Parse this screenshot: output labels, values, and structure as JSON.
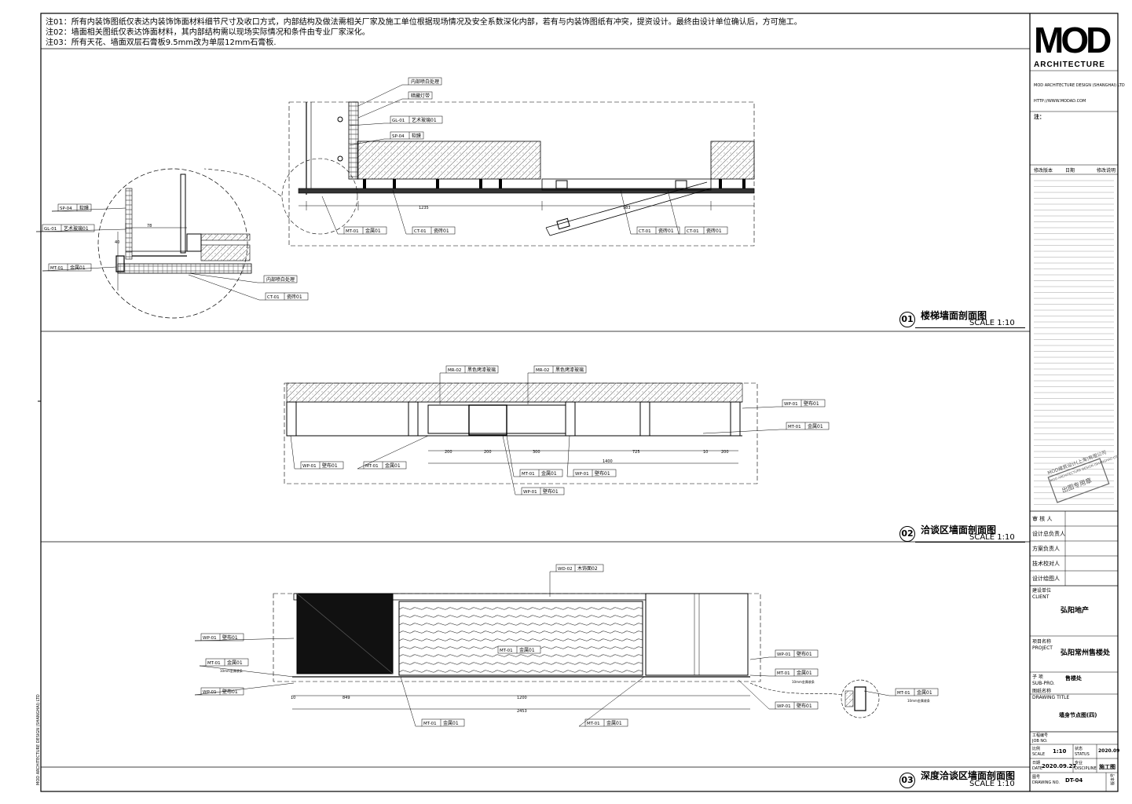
{
  "notes": [
    "注01：所有内装饰图纸仅表达内装饰饰面材料细节尺寸及收口方式，内部结构及做法需相关厂家及施工单位根据现场情况及安全系数深化内部，若有与内装饰图纸有冲突，提资设计。最终由设计单位确认后，方可施工。",
    "注02：墙面相关图纸仅表达饰面材料，其内部结构需以现场实际情况和条件由专业厂家深化。",
    "注03：所有天花、墙面双层石膏板9.5mm改为单层12mm石膏板."
  ],
  "sections": [
    {
      "num": "01",
      "title": "楼梯墙面剖面图",
      "scale": "SCALE  1:10"
    },
    {
      "num": "02",
      "title": "洽谈区墙面剖面图",
      "scale": "SCALE  1:10"
    },
    {
      "num": "03",
      "title": "深度洽谈区墙面剖面图",
      "scale": "SCALE  1:10"
    }
  ],
  "labels_01": {
    "l1": {
      "code": "",
      "text": "内部喷白处理"
    },
    "l2": {
      "code": "",
      "text": "暗藏灯带"
    },
    "l3": {
      "code": "GL-01",
      "text": "艺术玻璃01"
    },
    "l4": {
      "code": "SP-04",
      "text": "软膜"
    },
    "l5": {
      "code": "MT-01",
      "text": "金属01"
    },
    "l6": {
      "code": "CT-01",
      "text": "瓷砖01"
    },
    "l7": {
      "code": "CT-01",
      "text": "瓷砖01"
    },
    "l8": {
      "code": "CT-01",
      "text": "瓷砖01"
    },
    "d1": {
      "code": "SP-04",
      "text": "软膜"
    },
    "d2": {
      "code": "GL-01",
      "text": "艺术玻璃01"
    },
    "d3": {
      "code": "MT-01",
      "text": "金属01"
    },
    "d4": {
      "code": "",
      "text": "内部喷白处理"
    },
    "d5": {
      "code": "CT-01",
      "text": "瓷砖01"
    }
  },
  "dims_01": {
    "a": "1235",
    "b": "983",
    "c": "78",
    "d": "40"
  },
  "labels_02": {
    "t1": {
      "code": "MR-02",
      "text": "黑色烤漆玻璃"
    },
    "t2": {
      "code": "MR-02",
      "text": "黑色烤漆玻璃"
    },
    "r1": {
      "code": "WP-01",
      "text": "壁布01"
    },
    "r2": {
      "code": "MT-01",
      "text": "金属01"
    },
    "b1": {
      "code": "WP-01",
      "text": "壁布01"
    },
    "b2": {
      "code": "MT-01",
      "text": "金属01"
    },
    "b3": {
      "code": "MT-01",
      "text": "金属01"
    },
    "b4": {
      "code": "WP-01",
      "text": "壁布01"
    },
    "b5": {
      "code": "WP-01",
      "text": "壁布01"
    }
  },
  "dims_02": [
    "200",
    "200",
    "300",
    "725",
    "1400",
    "10",
    "200"
  ],
  "labels_03": {
    "top": {
      "code": "WD-02",
      "text": "木饰面02"
    },
    "l1": {
      "code": "WP-01",
      "text": "壁布01"
    },
    "l2": {
      "code": "MT-01",
      "text": "金属01"
    },
    "l2s": "10mm金属收条",
    "l3": {
      "code": "WP-01",
      "text": "壁布01"
    },
    "mid": {
      "code": "MT-01",
      "text": "金属01"
    },
    "r1": {
      "code": "WP-01",
      "text": "壁布01"
    },
    "r2": {
      "code": "MT-01",
      "text": "金属01"
    },
    "r2s": "10mm金属收条",
    "r3": {
      "code": "WP-01",
      "text": "壁布01"
    },
    "b1": {
      "code": "MT-01",
      "text": "金属01"
    },
    "b2": {
      "code": "MT-01",
      "text": "金属01"
    },
    "dt": {
      "code": "MT-01",
      "text": "金属01"
    },
    "dts": "10mm金属收条"
  },
  "dims_03": [
    "849",
    "1200",
    "2453",
    "10"
  ],
  "titleblock": {
    "logo_top": "MOD",
    "logo_bottom": "ARCHITECTURE",
    "company_lines": [
      "MOD ARCHITECTURE DESIGN (SHANGHAI) LTD",
      "",
      "HTTP://WWW.MODAD.COM"
    ],
    "notes_head": "注：",
    "table_head": [
      "修改版本",
      "日期",
      "修改说明"
    ],
    "stamp_lines": [
      "MOD建筑设计(上海)有限公司",
      "MOD ARCHITECTURE DESIGN (SHANGHAI) LTD",
      "出图专用章"
    ],
    "roles": [
      "审 核 人",
      "设计总负责人",
      "方案负责人",
      "技术校对人",
      "设计绘图人"
    ],
    "client_label": "建设单位\nCLIENT",
    "client": "弘阳地产",
    "project_label": "项目名称\nPROJECT",
    "project": "弘阳常州售楼处",
    "sub_label": "子 项\nSUB-PRO.",
    "sub": "售楼处",
    "drawing_label": "图纸名称\nDRAWING TITLE",
    "drawing": "墙身节点图(四)",
    "job_label": "工程编号\nJOB NO.",
    "scale_label": "比例\nSCALE",
    "scale": "1:10",
    "status_label": "状态\nSTATUS",
    "status": "2020.09",
    "date_label": "日期\nDATE",
    "date": "2020.09.27",
    "disc_label": "专业\nDISCIPLINE",
    "disc": "施工图",
    "dwg_label": "图号\nDRAWING NO.",
    "dwg": "DT-04",
    "version": "版本号"
  },
  "side_text": "MOD ARCHITECTURE DESIGN (SHANGHAI) LTD"
}
